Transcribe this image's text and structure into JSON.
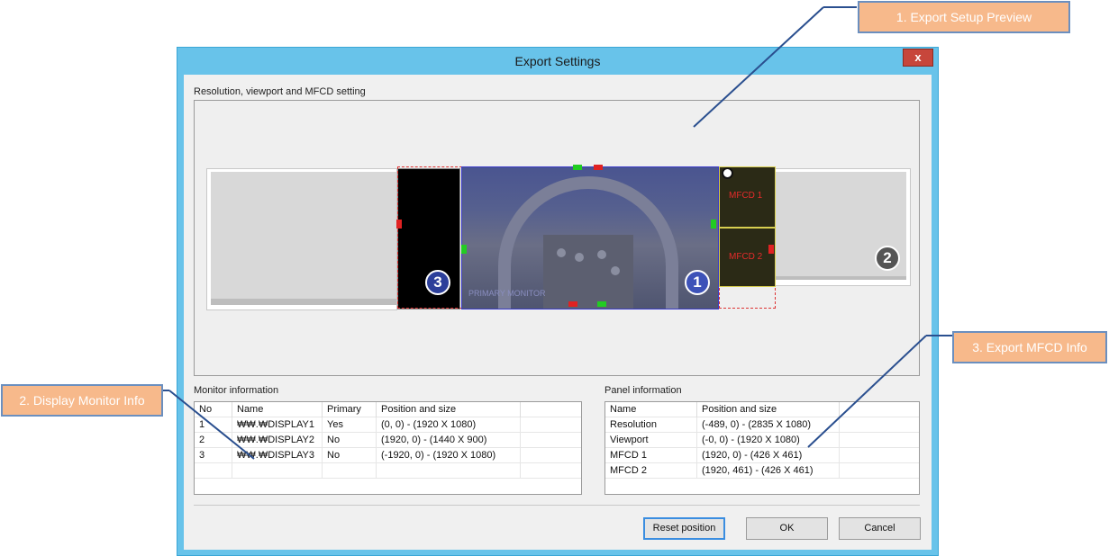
{
  "window": {
    "title": "Export Settings",
    "close_label": "x"
  },
  "preview": {
    "label": "Resolution, viewport and MFCD setting",
    "primary_monitor_label": "PRIMARY MONITOR",
    "badges": [
      "1",
      "2",
      "3"
    ],
    "mfcd_labels": [
      "MFCD 1",
      "MFCD 2"
    ]
  },
  "monitor_info": {
    "label": "Monitor information",
    "columns": [
      "No",
      "Name",
      "Primary",
      "Position and size"
    ],
    "rows": [
      [
        "1",
        "₩₩.₩DISPLAY1",
        "Yes",
        "(0, 0) - (1920 X 1080)"
      ],
      [
        "2",
        "₩₩.₩DISPLAY2",
        "No",
        "(1920, 0) - (1440 X 900)"
      ],
      [
        "3",
        "₩₩.₩DISPLAY3",
        "No",
        "(-1920, 0) - (1920 X 1080)"
      ]
    ]
  },
  "panel_info": {
    "label": "Panel information",
    "columns": [
      "Name",
      "Position and size"
    ],
    "rows": [
      [
        "Resolution",
        "(-489, 0) - (2835 X 1080)"
      ],
      [
        "Viewport",
        "(-0, 0) - (1920 X 1080)"
      ],
      [
        "MFCD 1",
        "(1920, 0) - (426 X 461)"
      ],
      [
        "MFCD 2",
        "(1920, 461) - (426 X 461)"
      ]
    ]
  },
  "buttons": {
    "reset": "Reset position",
    "ok": "OK",
    "cancel": "Cancel"
  },
  "callouts": {
    "export_setup_preview": "1. Export Setup Preview",
    "display_monitor_info": "2. Display Monitor Info",
    "export_mfcd_info": "3. Export MFCD Info"
  },
  "colors": {
    "accent": "#68c3ea",
    "callout_fill": "#f7b98b",
    "callout_line": "#2a4f8f",
    "mfcd_text": "#e52b2b"
  }
}
